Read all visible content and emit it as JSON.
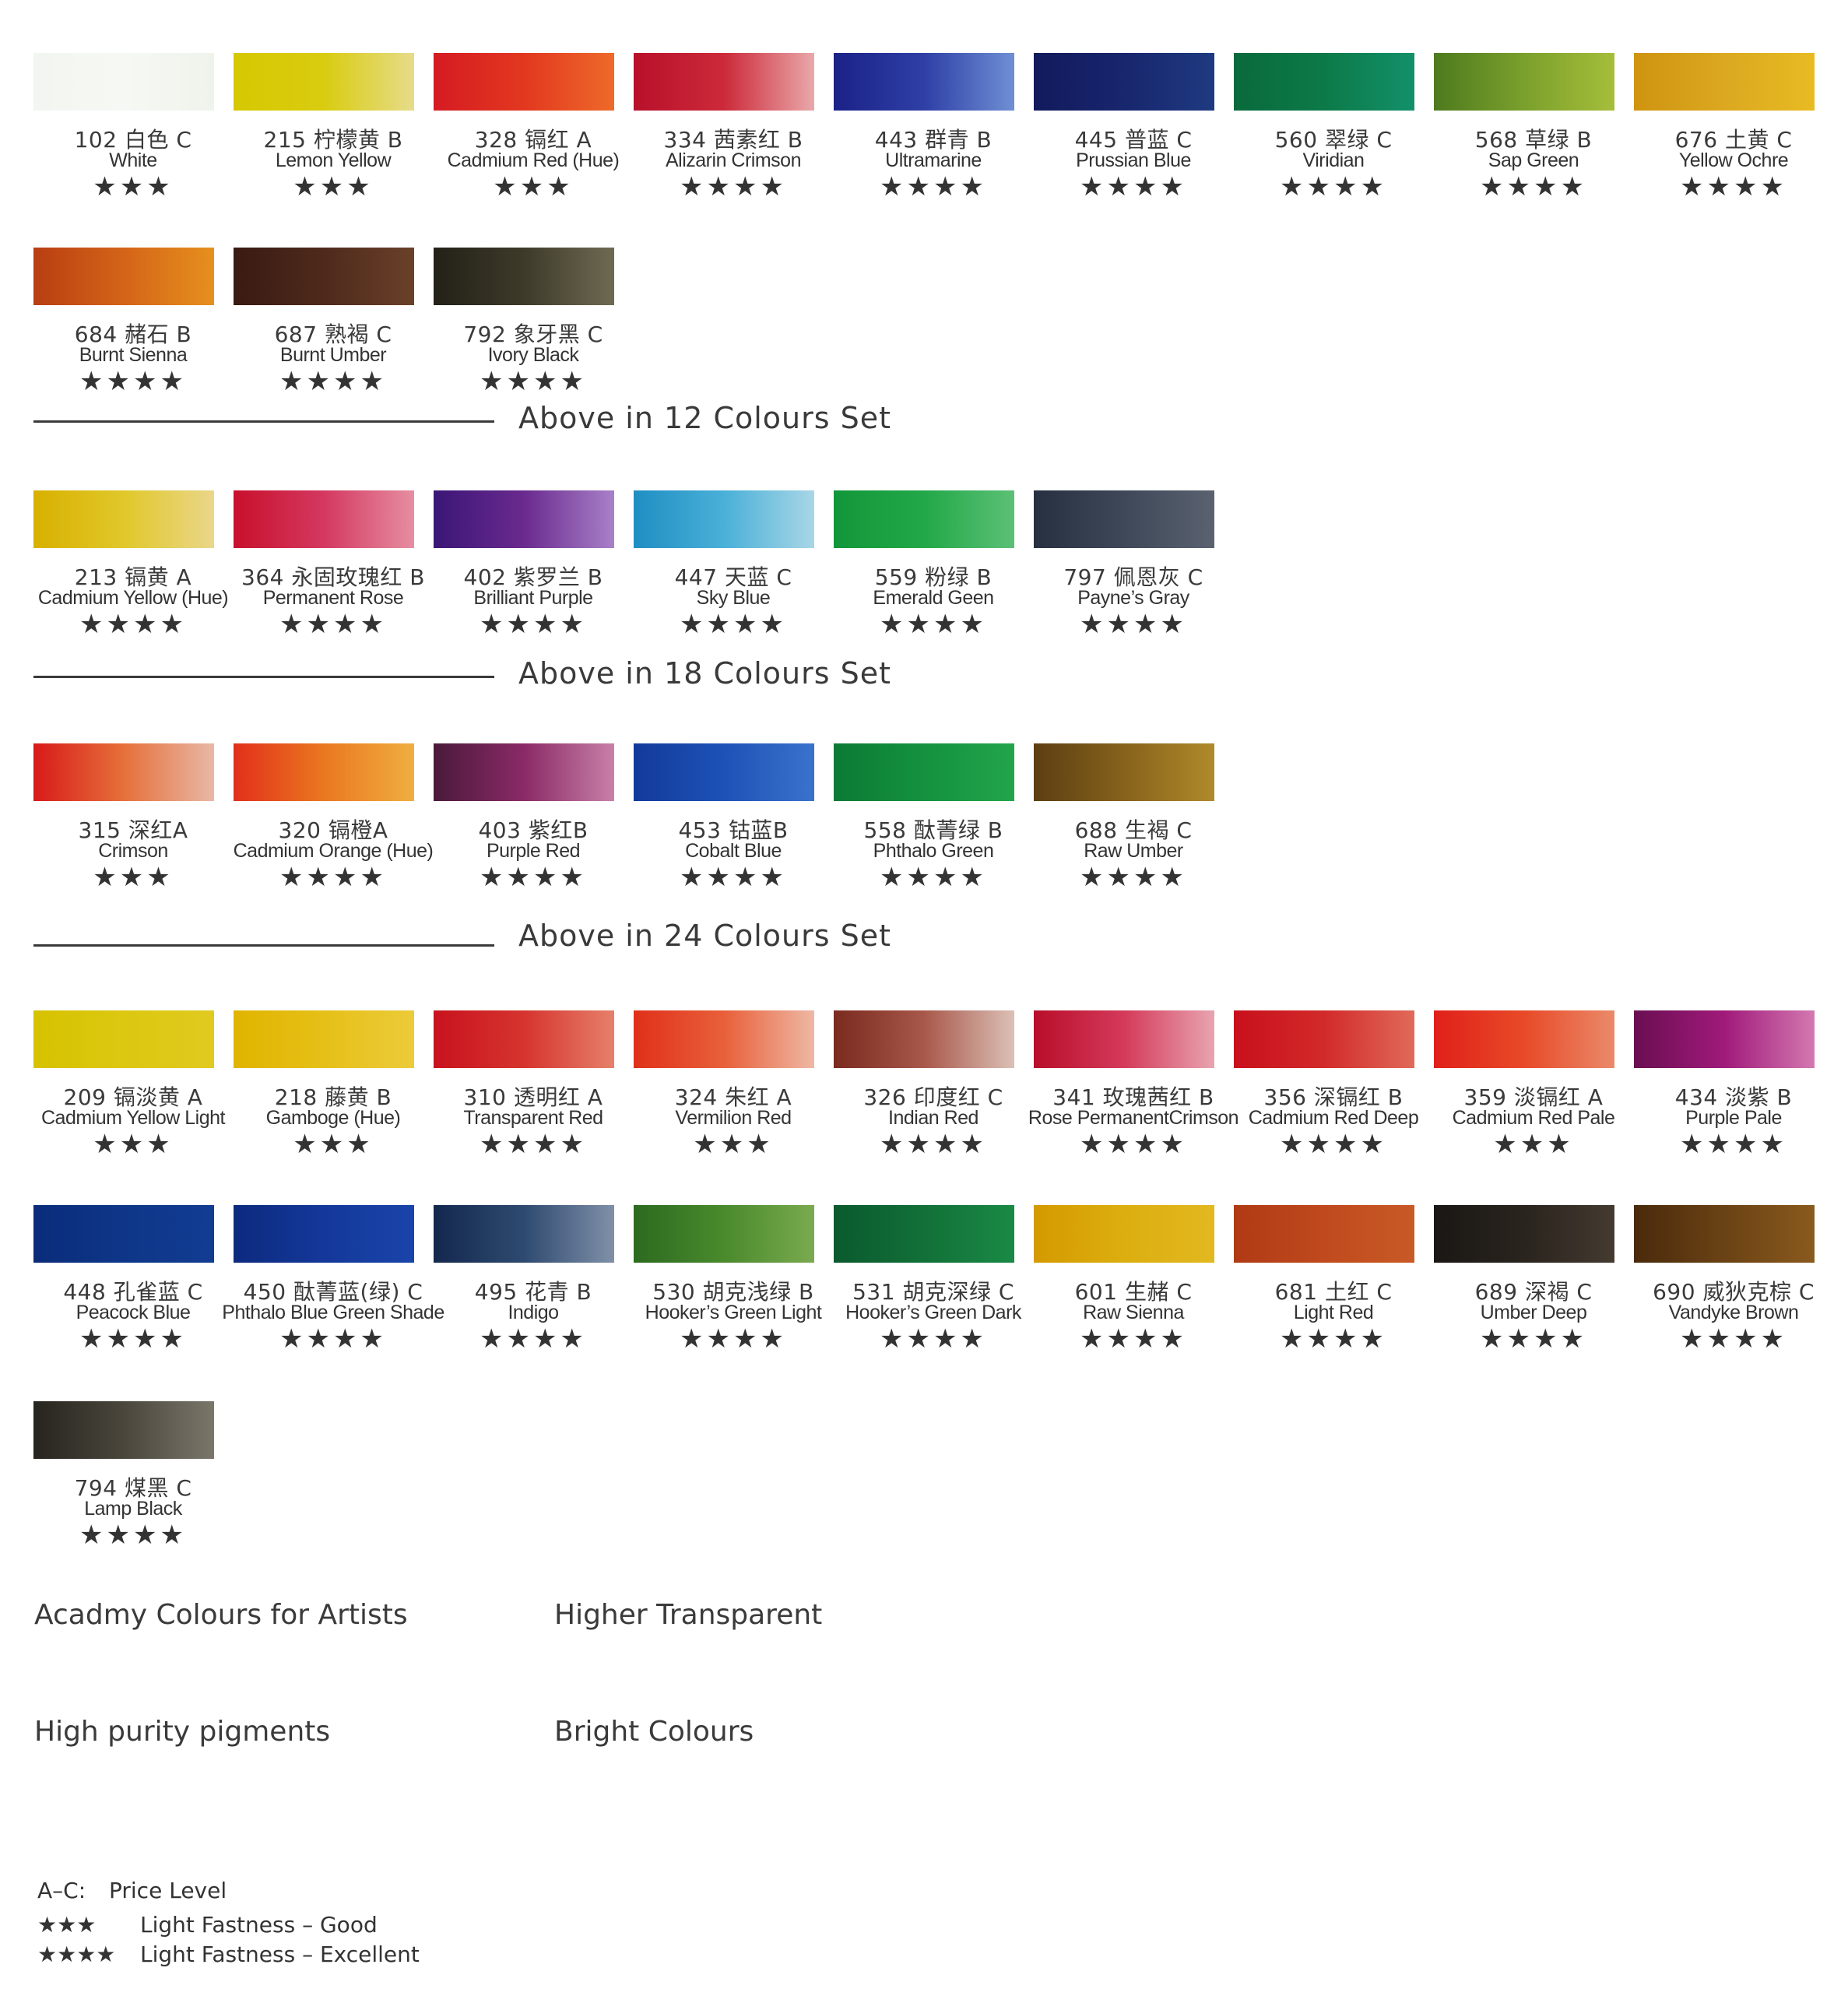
{
  "sections": [
    {
      "rows": [
        [
          {
            "code": "102 白色 C",
            "name": "White",
            "stars": "★★★",
            "gradient": [
              "#f2f6f0",
              "#f6f9f3",
              "#eef3ec"
            ]
          },
          {
            "code": "215 柠檬黄 B",
            "name": "Lemon Yellow",
            "stars": "★★★",
            "gradient": [
              "#d6c800",
              "#d9cc10",
              "#e6dc8a"
            ]
          },
          {
            "code": "328 镉红 A",
            "name": "Cadmium Red (Hue)",
            "stars": "★★★",
            "gradient": [
              "#d51b22",
              "#e2381f",
              "#ee6a2a"
            ]
          },
          {
            "code": "334 茜素红 B",
            "name": "Alizarin Crimson",
            "stars": "★★★★",
            "gradient": [
              "#b8102a",
              "#cc2a3a",
              "#e9a8aa"
            ]
          },
          {
            "code": "443 群青 B",
            "name": "Ultramarine",
            "stars": "★★★★",
            "gradient": [
              "#1b2288",
              "#2e3fa6",
              "#6f8fd4"
            ]
          },
          {
            "code": "445 普蓝 C",
            "name": "Prussian Blue",
            "stars": "★★★★",
            "gradient": [
              "#121a5c",
              "#18266e",
              "#1e3a80"
            ]
          },
          {
            "code": "560 翠绿 C",
            "name": "Viridian",
            "stars": "★★★★",
            "gradient": [
              "#0a6a3c",
              "#0c7a48",
              "#13906a"
            ]
          },
          {
            "code": "568 草绿 B",
            "name": "Sap Green",
            "stars": "★★★★",
            "gradient": [
              "#4e7a1e",
              "#7aa02c",
              "#a6be3a"
            ]
          },
          {
            "code": "676 土黄 C",
            "name": "Yellow Ochre",
            "stars": "★★★★",
            "gradient": [
              "#cf9410",
              "#dba820",
              "#e8bb22"
            ]
          }
        ],
        [
          {
            "code": "684 赭石 B",
            "name": "Burnt Sienna",
            "stars": "★★★★",
            "gradient": [
              "#b83e12",
              "#d46418",
              "#e6901e"
            ]
          },
          {
            "code": "687 熟褐 C",
            "name": "Burnt Umber",
            "stars": "★★★★",
            "gradient": [
              "#3a1a12",
              "#4e2a1c",
              "#6a4028"
            ]
          },
          {
            "code": "792 象牙黑 C",
            "name": "Ivory Black",
            "stars": "★★★★",
            "gradient": [
              "#222118",
              "#3e3a2a",
              "#6e6a52"
            ]
          }
        ]
      ],
      "set_label": "Above in 12 Colours Set"
    },
    {
      "rows": [
        [
          {
            "code": "213 镉黄 A",
            "name": "Cadmium Yellow (Hue)",
            "stars": "★★★★",
            "gradient": [
              "#d8b000",
              "#e0c82a",
              "#ead68a"
            ]
          },
          {
            "code": "364 永固玫瑰红 B",
            "name": "Permanent Rose",
            "stars": "★★★★",
            "gradient": [
              "#c8102c",
              "#d43860",
              "#e68ea2"
            ]
          },
          {
            "code": "402 紫罗兰 B",
            "name": "Brilliant Purple",
            "stars": "★★★★",
            "gradient": [
              "#3a1676",
              "#6a2a8e",
              "#a880c8"
            ]
          },
          {
            "code": "447 天蓝 C",
            "name": "Sky Blue",
            "stars": "★★★★",
            "gradient": [
              "#1e8ec2",
              "#4ab0d8",
              "#a8d6e6"
            ]
          },
          {
            "code": "559 粉绿 B",
            "name": "Emerald Geen",
            "stars": "★★★★",
            "gradient": [
              "#12963a",
              "#22a848",
              "#5cc076"
            ]
          },
          {
            "code": "797 佩恩灰 C",
            "name": "Payne’s Gray",
            "stars": "★★★★",
            "gradient": [
              "#263040",
              "#3e4858",
              "#5a6270"
            ]
          }
        ]
      ],
      "set_label": "Above in 18 Colours Set"
    },
    {
      "rows": [
        [
          {
            "code": "315 深红A",
            "name": "Crimson",
            "stars": "★★★",
            "gradient": [
              "#d81a1a",
              "#e6703a",
              "#e8b8a6"
            ]
          },
          {
            "code": "320 镉橙A",
            "name": "Cadmium Orange (Hue)",
            "stars": "★★★★",
            "gradient": [
              "#e2301a",
              "#ea7820",
              "#f0ae40"
            ]
          },
          {
            "code": "403 紫红B",
            "name": "Purple Red",
            "stars": "★★★★",
            "gradient": [
              "#4a1a3a",
              "#8a2a66",
              "#c880a8"
            ]
          },
          {
            "code": "453 钴蓝B",
            "name": "Cobalt Blue",
            "stars": "★★★★",
            "gradient": [
              "#123a9a",
              "#1e52b6",
              "#3a72cc"
            ]
          },
          {
            "code": "558 酞菁绿 B",
            "name": "Phthalo Green",
            "stars": "★★★★",
            "gradient": [
              "#0c7a34",
              "#14923e",
              "#22a44c"
            ]
          },
          {
            "code": "688 生褐 C",
            "name": "Raw Umber",
            "stars": "★★★★",
            "gradient": [
              "#5c3e12",
              "#86621c",
              "#b08a2a"
            ]
          }
        ]
      ],
      "set_label": "Above in 24 Colours Set"
    },
    {
      "rows": [
        [
          {
            "code": "209 镉淡黄 A",
            "name": "Cadmium Yellow Light",
            "stars": "★★★",
            "gradient": [
              "#d6c200",
              "#dcc810",
              "#e0ca20"
            ]
          },
          {
            "code": "218 藤黄 B",
            "name": "Gamboge (Hue)",
            "stars": "★★★",
            "gradient": [
              "#e0b400",
              "#e6c018",
              "#eccb3a"
            ]
          },
          {
            "code": "310 透明红 A",
            "name": "Transparent Red",
            "stars": "★★★★",
            "gradient": [
              "#c8121e",
              "#d6342e",
              "#e6806a"
            ]
          },
          {
            "code": "324 朱红 A",
            "name": "Vermilion Red",
            "stars": "★★★",
            "gradient": [
              "#e0301a",
              "#e8603a",
              "#eeb8a4"
            ]
          },
          {
            "code": "326 印度红 C",
            "name": "Indian Red",
            "stars": "★★★★",
            "gradient": [
              "#7a2a1e",
              "#a8584a",
              "#dcc0b6"
            ]
          },
          {
            "code": "341 玫瑰茜红 B",
            "name": "Rose PermanentCrimson",
            "stars": "★★★★",
            "gradient": [
              "#b80e2a",
              "#d43a5a",
              "#e8a4b0"
            ]
          },
          {
            "code": "356 深镉红 B",
            "name": "Cadmium Red Deep",
            "stars": "★★★★",
            "gradient": [
              "#c8101c",
              "#d22a2a",
              "#e06a5a"
            ]
          },
          {
            "code": "359 淡镉红 A",
            "name": "Cadmium Red Pale",
            "stars": "★★★",
            "gradient": [
              "#e0201a",
              "#e84a28",
              "#ea8a6a"
            ]
          },
          {
            "code": "434 淡紫 B",
            "name": "Purple Pale",
            "stars": "★★★★",
            "gradient": [
              "#6a0e52",
              "#a01a7a",
              "#d478b0"
            ]
          }
        ],
        [
          {
            "code": "448 孔雀蓝 C",
            "name": "Peacock Blue",
            "stars": "★★★★",
            "gradient": [
              "#0a2c7a",
              "#0e3688",
              "#123c92"
            ]
          },
          {
            "code": "450 酞菁蓝(绿) C",
            "name": "Phthalo Blue Green Shade",
            "stars": "★★★★",
            "gradient": [
              "#0c2a7e",
              "#14389a",
              "#1a44aa"
            ]
          },
          {
            "code": "495 花青 B",
            "name": "Indigo",
            "stars": "★★★★",
            "gradient": [
              "#14284e",
              "#2e4a70",
              "#8090a8"
            ]
          },
          {
            "code": "530 胡克浅绿 B",
            "name": "Hooker’s Green Light",
            "stars": "★★★★",
            "gradient": [
              "#2c6a20",
              "#4a8a2c",
              "#7aaa50"
            ]
          },
          {
            "code": "531 胡克深绿 C",
            "name": "Hooker’s Green Dark",
            "stars": "★★★★",
            "gradient": [
              "#0a5a2e",
              "#127038",
              "#1a8a46"
            ]
          },
          {
            "code": "601 生赭 C",
            "name": "Raw Sienna",
            "stars": "★★★★",
            "gradient": [
              "#d49a00",
              "#dcae10",
              "#e2b820"
            ]
          },
          {
            "code": "681 土红 C",
            "name": "Light Red",
            "stars": "★★★★",
            "gradient": [
              "#b03a14",
              "#c04a1e",
              "#c85a26"
            ]
          },
          {
            "code": "689 深褐 C",
            "name": "Umber Deep",
            "stars": "★★★★",
            "gradient": [
              "#1a1714",
              "#2a241e",
              "#443a30"
            ]
          },
          {
            "code": "690 威狄克棕 C",
            "name": "Vandyke Brown",
            "stars": "★★★★",
            "gradient": [
              "#4a2a0c",
              "#6a4214",
              "#8a5a1e"
            ]
          }
        ],
        [
          {
            "code": "794 煤黑 C",
            "name": "Lamp Black",
            "stars": "★★★★",
            "gradient": [
              "#26241e",
              "#4a463c",
              "#7a766a"
            ]
          }
        ]
      ],
      "set_label": ""
    }
  ],
  "features": [
    "Acadmy Colours for Artists",
    "Higher Transparent",
    "High purity pigments",
    "Bright Colours"
  ],
  "legend": [
    {
      "key": "A–C:",
      "text": "Price Level"
    },
    {
      "key": "★★★",
      "text": "Light Fastness – Good"
    },
    {
      "key": "★★★★",
      "text": "Light Fastness – Excellent"
    }
  ]
}
